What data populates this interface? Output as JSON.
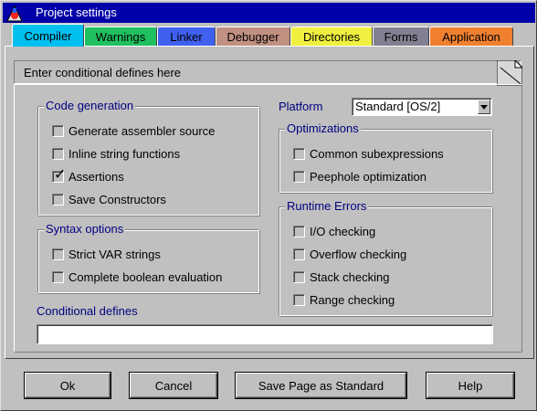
{
  "window": {
    "title": "Project settings"
  },
  "tabs": [
    {
      "label": "Compiler",
      "color": "#00c0f0",
      "active": true
    },
    {
      "label": "Warnings",
      "color": "#20c060"
    },
    {
      "label": "Linker",
      "color": "#4060f0"
    },
    {
      "label": "Debugger",
      "color": "#c09080"
    },
    {
      "label": "Directories",
      "color": "#f0f040"
    },
    {
      "label": "Forms",
      "color": "#808090"
    },
    {
      "label": "Application",
      "color": "#f08030"
    }
  ],
  "hint": "Enter conditional defines here",
  "code_generation": {
    "title": "Code generation",
    "items": [
      {
        "label": "Generate assembler source",
        "checked": false
      },
      {
        "label": "Inline string functions",
        "checked": false
      },
      {
        "label": "Assertions",
        "checked": true
      },
      {
        "label": "Save Constructors",
        "checked": false
      }
    ]
  },
  "syntax_options": {
    "title": "Syntax options",
    "items": [
      {
        "label": "Strict VAR strings",
        "checked": false
      },
      {
        "label": "Complete boolean evaluation",
        "checked": false
      }
    ]
  },
  "platform": {
    "label": "Platform",
    "value": "Standard [OS/2]"
  },
  "optimizations": {
    "title": "Optimizations",
    "items": [
      {
        "label": "Common subexpressions",
        "checked": false
      },
      {
        "label": "Peephole optimization",
        "checked": false
      }
    ]
  },
  "runtime_errors": {
    "title": "Runtime Errors",
    "items": [
      {
        "label": "I/O checking",
        "checked": false
      },
      {
        "label": "Overflow checking",
        "checked": false
      },
      {
        "label": "Stack checking",
        "checked": false
      },
      {
        "label": "Range checking",
        "checked": false
      }
    ]
  },
  "conditional_defines": {
    "label": "Conditional defines",
    "value": ""
  },
  "buttons": {
    "ok": "Ok",
    "cancel": "Cancel",
    "save_standard": "Save Page as Standard",
    "help": "Help"
  }
}
